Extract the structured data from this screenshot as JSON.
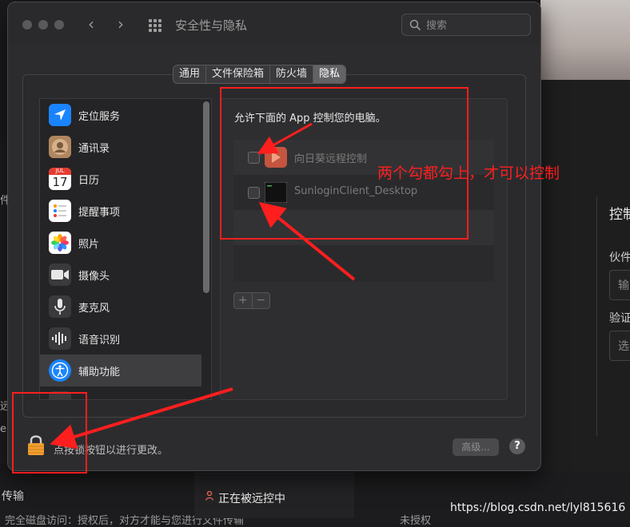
{
  "window": {
    "title": "安全性与隐私",
    "nav_back": "‹",
    "nav_forward": "›",
    "search_placeholder": "搜索"
  },
  "tabs": [
    {
      "label": "通用",
      "active": false
    },
    {
      "label": "文件保险箱",
      "active": false
    },
    {
      "label": "防火墙",
      "active": false
    },
    {
      "label": "隐私",
      "active": true
    }
  ],
  "sidebar": {
    "items": [
      {
        "label": "定位服务",
        "icon": "location-icon",
        "color": "#1a84ff"
      },
      {
        "label": "通讯录",
        "icon": "contacts-icon",
        "color": "#b08660"
      },
      {
        "label": "日历",
        "icon": "calendar-icon",
        "color": "#ffffff"
      },
      {
        "label": "提醒事项",
        "icon": "reminders-icon",
        "color": "#ffffff"
      },
      {
        "label": "照片",
        "icon": "photos-icon",
        "color": "#ffffff"
      },
      {
        "label": "摄像头",
        "icon": "camera-icon",
        "color": "#3a3a3c"
      },
      {
        "label": "麦克风",
        "icon": "microphone-icon",
        "color": "#3a3a3c"
      },
      {
        "label": "语音识别",
        "icon": "speech-icon",
        "color": "#3a3a3c"
      },
      {
        "label": "辅助功能",
        "icon": "accessibility-icon",
        "color": "#1a84ff",
        "selected": true
      }
    ],
    "calendar_month": "JUL",
    "calendar_day": "17"
  },
  "privacy": {
    "allow_text": "允许下面的 App 控制您的电脑。",
    "apps": [
      {
        "name": "向日葵远程控制",
        "checked": false,
        "icon": "sunlogin-icon"
      },
      {
        "name": "SunloginClient_Desktop",
        "checked": false,
        "icon": "terminal-icon"
      }
    ],
    "add_label": "+",
    "remove_label": "−"
  },
  "footer": {
    "lock_text": "点按锁按钮以进行更改。",
    "advanced_label": "高级...",
    "help_label": "?"
  },
  "annotation": {
    "text": "两个勾都勾上，才可以控制",
    "color": "#ff1e1e"
  },
  "background": {
    "right_title": "控制",
    "right_label1": "伙件",
    "right_input1": "输",
    "right_label2": "验证",
    "right_input2": "选",
    "left_label1": "件",
    "left_label2": "远",
    "left_label3": "e",
    "bottom_left1": "传输",
    "bottom_left2": "完全磁盘访问：授权后，对方才能与您进行文件传输",
    "bottom_right": "未授权",
    "status_text": "正在被远控中",
    "watermark": "https://blog.csdn.net/lyl815616"
  }
}
